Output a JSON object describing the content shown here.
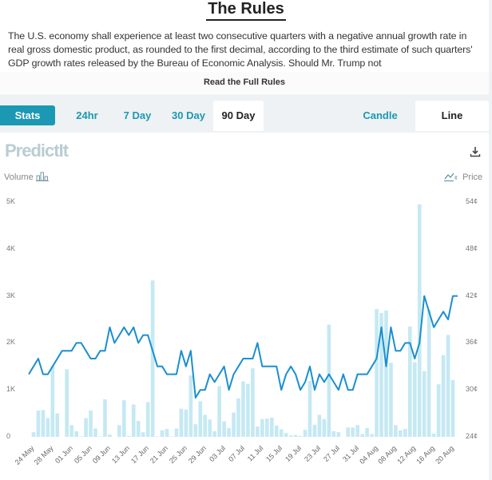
{
  "rules": {
    "title": "The Rules",
    "text": "The U.S. economy shall experience at least two consecutive quarters with a negative annual growth rate in real gross domestic product, as rounded to the first decimal, according to the third estimate of such quarters' GDP growth rates released by the Bureau of Economic Analysis. Should Mr. Trump not",
    "read_more": "Read the Full Rules"
  },
  "tabs": {
    "stats": "Stats",
    "ranges": [
      "24hr",
      "7 Day",
      "30 Day",
      "90 Day"
    ],
    "active_range": "90 Day",
    "chart_types": [
      "Candle",
      "Line"
    ],
    "active_chart_type": "Line"
  },
  "chart_header": {
    "logo": "PredictIt",
    "volume_label": "Volume",
    "price_label": "Price",
    "download_icon": "download-icon"
  },
  "colors": {
    "accent": "#1a98b4",
    "line": "#1a8fd0",
    "bar": "#c5e9f3"
  },
  "chart_data": {
    "type": "bar+line",
    "title": "",
    "left_axis": {
      "label": "Volume",
      "ticks": [
        "0",
        "1K",
        "2K",
        "3K",
        "4K",
        "5K"
      ],
      "range": [
        0,
        5000
      ]
    },
    "right_axis": {
      "label": "Price",
      "ticks": [
        "24¢",
        "30¢",
        "36¢",
        "42¢",
        "48¢",
        "54¢"
      ],
      "range": [
        24,
        54
      ]
    },
    "x_ticks": [
      "24 May",
      "28 May",
      "01 Jun",
      "05 Jun",
      "09 Jun",
      "13 Jun",
      "17 Jun",
      "21 Jun",
      "25 Jun",
      "29 Jun",
      "03 Jul",
      "07 Jul",
      "11 Jul",
      "15 Jul",
      "19 Jul",
      "23 Jul",
      "27 Jul",
      "31 Jul",
      "04 Aug",
      "08 Aug",
      "12 Aug",
      "16 Aug",
      "20 Aug"
    ],
    "grid": false,
    "series": [
      {
        "name": "Volume",
        "type": "bar",
        "values": [
          0,
          100,
          560,
          570,
          400,
          1510,
          500,
          0,
          1440,
          250,
          120,
          10,
          400,
          560,
          180,
          10,
          800,
          50,
          0,
          250,
          780,
          20,
          690,
          340,
          100,
          740,
          3330,
          10,
          140,
          170,
          10,
          180,
          600,
          580,
          1310,
          270,
          760,
          470,
          370,
          120,
          1080,
          330,
          190,
          520,
          820,
          1180,
          1130,
          1460,
          220,
          380,
          390,
          410,
          240,
          160,
          80,
          30,
          40,
          20,
          150,
          1190,
          260,
          470,
          380,
          2390,
          120,
          100,
          0,
          200,
          200,
          250,
          60,
          190,
          60,
          2720,
          2640,
          2690,
          1580,
          250,
          140,
          170,
          2350,
          1590,
          4950,
          1400,
          2700,
          70,
          1120,
          1740,
          2170,
          1210
        ]
      },
      {
        "name": "Price",
        "type": "line",
        "unit": "¢",
        "values": [
          32,
          33,
          34,
          32,
          32,
          33,
          34,
          35,
          35,
          35,
          36,
          36,
          35,
          34,
          34,
          35,
          35,
          38,
          36,
          37,
          38,
          37,
          38,
          36,
          37,
          37,
          35,
          33,
          33,
          32,
          32,
          32,
          35,
          33,
          35,
          29,
          30,
          30,
          32,
          31,
          32,
          33,
          30,
          32,
          33,
          34,
          34,
          34,
          36,
          33,
          33,
          33,
          33,
          30,
          32,
          33,
          32,
          30,
          31,
          33,
          30,
          32,
          31,
          32,
          31,
          30,
          32,
          30,
          30,
          32,
          32,
          32,
          33,
          34,
          38,
          33,
          38,
          35,
          35,
          36,
          36,
          34,
          36,
          42,
          40,
          38,
          39,
          40,
          39,
          42,
          42
        ]
      }
    ]
  }
}
